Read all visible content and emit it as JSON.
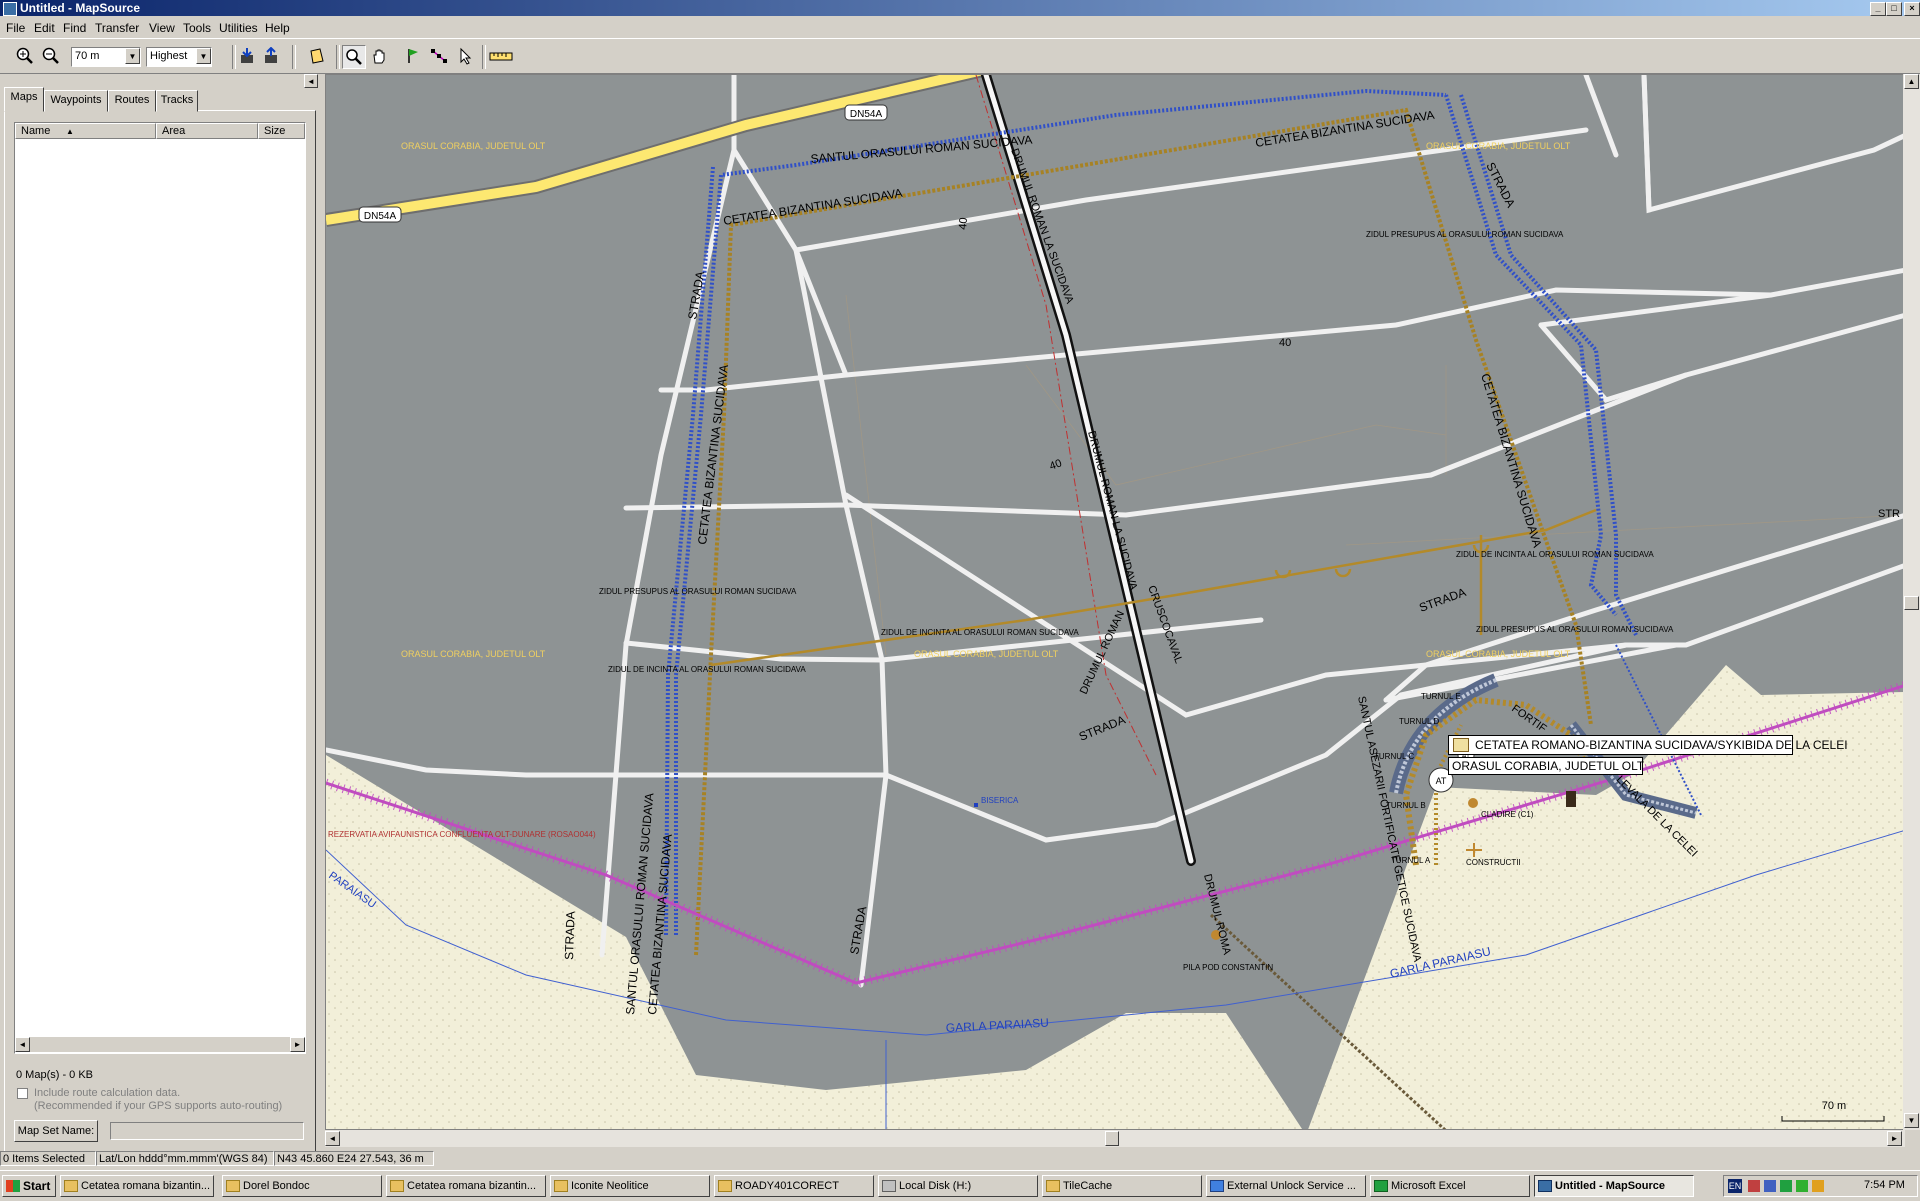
{
  "window": {
    "title": "Untitled - MapSource",
    "min": "_",
    "max": "□",
    "close": "×"
  },
  "menu": [
    "File",
    "Edit",
    "Find",
    "Transfer",
    "View",
    "Tools",
    "Utilities",
    "Help"
  ],
  "toolbar": {
    "zoom_value": "70 m",
    "detail_value": "Highest"
  },
  "tabs": [
    "Maps",
    "Waypoints",
    "Routes",
    "Tracks"
  ],
  "maps_list": {
    "columns": [
      "Name",
      "Area",
      "Size"
    ],
    "summary": "0 Map(s) - 0 KB",
    "checkbox_label": "Include route calculation data.",
    "checkbox_hint": "(Recommended if your GPS supports auto-routing)",
    "mapset_button": "Map Set Name:",
    "mapset_value": ""
  },
  "map": {
    "labels": {
      "dn54a_1": "DN54A",
      "dn54a_2": "DN54A",
      "santul_top": "SANTUL ORASULUI ROMAN SUCIDAVA",
      "cetatea_top": "CETATEA BIZANTINA SUCIDAVA",
      "cetatea_top_right": "CETATEA BIZANTINA SUCIDAVA",
      "orasul_1": "ORASUL CORABIA, JUDETUL OLT",
      "orasul_2": "ORASUL CORABIA, JUDETUL OLT",
      "orasul_3": "ORASUL CORABIA, JUDETUL OLT",
      "orasul_4": "ORASUL CORABIA, JUDETUL OLT",
      "orasul_5": "ORASUL CORABIA, JUDETUL OLT",
      "zidul_presupus_1": "ZIDUL PRESUPUS AL ORASULUI ROMAN SUCIDAVA",
      "zidul_presupus_2": "ZIDUL PRESUPUS AL ORASULUI ROMAN SUCIDAVA",
      "zidul_presupus_3": "ZIDUL PRESUPUS AL ORASULUI ROMAN SUCIDAVA",
      "zidul_incinta_1": "ZIDUL DE INCINTA AL ORASULUI ROMAN SUCIDAVA",
      "zidul_incinta_2": "ZIDUL DE INCINTA AL ORASULUI ROMAN SUCIDAVA",
      "zidul_incinta_3": "ZIDUL DE INCINTA AL ORASULUI ROMAN SUCIDAVA",
      "strada_1": "STRADA",
      "strada_2": "STRADA",
      "strada_3": "STRADA",
      "strada_4": "STRADA",
      "strada_5": "STRADA",
      "strada_6": "STRADA",
      "drumul_1": "DRUMUL ROMAN LA SUCIDAVA",
      "drumul_2": "DRUMUL ROMAN LA SUCIDAVA",
      "drumul_3": "DRUMUL ROMAN",
      "drumul_4": "DRUMUL ROMA",
      "ciruscucaval": "CRUSCOCAVAL",
      "cetatea_left": "CETATEA BIZANTINA SUCIDAVA",
      "cetatea_right": "CETATEA BIZANTINA SUCIDAVA",
      "santul_left": "SANTUL ORASULUI ROMAN SUCIDAVA",
      "cetatea_bottom_left": "CETATEA BIZANTINA SUCIDAVA",
      "garla_1": "GARLA PARAIASU",
      "garla_2": "GARLA PARAIASU",
      "paraiasu": "PARAIASU",
      "rezervatia": "REZERVATIA AVIFAUNISTICA CONFLUENTA OLT-DUNARE (ROSAO044)",
      "biserica": "BISERICA",
      "pila_pod": "PILA POD CONSTANTIN",
      "speed_1": "40",
      "speed_2": "40",
      "speed_3": "40",
      "turnul_e": "TURNUL E",
      "turnul_d": "TURNUL D",
      "turnul_c": "TURNUL C",
      "turnul_b": "TURNUL B",
      "turnul_a": "TURNUL A",
      "cladire": "CLADIRE (C1)",
      "constructii": "CONSTRUCTII",
      "fortif": "FORTIF",
      "santul_asezarii": "SANTUL ASEZARII FORTIFICATE GETICE SUCIDAVA",
      "levala": "LEVALA DE LA CELEI",
      "str_right": "STR"
    },
    "tooltip_line1": "CETATEA ROMANO-BIZANTINA SUCIDAVA/SYKIBIDA DE LA CELEI",
    "tooltip_line2": "ORASUL CORABIA, JUDETUL OLT",
    "scale_label": "70 m",
    "colors": {
      "land": "#8e9394",
      "background": "#f2efd9",
      "road": "#fde871",
      "river": "#4060d0",
      "railway": "#c04cc0",
      "wall": "#b38a2a"
    }
  },
  "status": {
    "selected": "0 Items Selected",
    "format": "Lat/Lon hddd°mm.mmm'(WGS 84)",
    "position": "N43 45.860 E24 27.543, 36 m"
  },
  "taskbar": {
    "start": "Start",
    "tasks": [
      "Cetatea romana bizantin...",
      "Dorel Bondoc",
      "Cetatea romana bizantin...",
      "Iconite Neolitice",
      "ROADY401CORECT",
      "Local Disk (H:)",
      "TileCache",
      "External Unlock Service ...",
      "Microsoft Excel",
      "Untitled - MapSource"
    ],
    "lang": "EN",
    "clock": "7:54 PM"
  }
}
